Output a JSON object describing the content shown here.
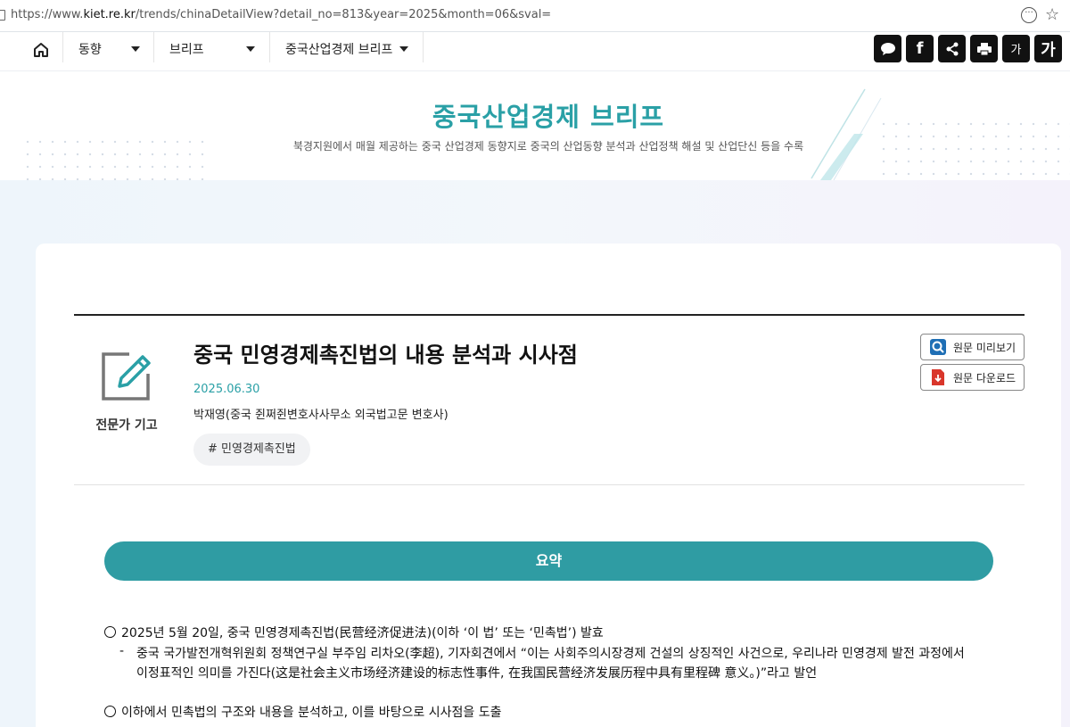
{
  "browser": {
    "url_prefix": "https://www.",
    "url_domain": "kiet.re.kr",
    "url_rest": "/trends/chinaDetailView?detail_no=813&year=2025&month=06&sval="
  },
  "nav": {
    "items": [
      {
        "label": "동향"
      },
      {
        "label": "브리프"
      },
      {
        "label": "중국산업경제 브리프"
      }
    ],
    "tools": [
      {
        "icon": "speech-bubble-icon"
      },
      {
        "icon": "facebook-icon",
        "label": "f"
      },
      {
        "icon": "share-icon"
      },
      {
        "icon": "print-icon"
      },
      {
        "icon": "font-decrease-icon",
        "label": "가"
      },
      {
        "icon": "font-increase-icon",
        "label": "가"
      }
    ]
  },
  "banner": {
    "title": "중국산업경제 브리프",
    "subtitle": "북경지원에서 매월 제공하는 중국 산업경제 동향지로 중국의 산업동향 분석과 산업정책 해설 및 산업단신 등을 수록"
  },
  "article": {
    "category": "전문가 기고",
    "title": "중국 민영경제촉진법의 내용 분석과 시사점",
    "date": "2025.06.30",
    "author": "박재영(중국 쥔쩌쥔변호사사무소 외국법고문 변호사)",
    "tag": "# 민영경제촉진법",
    "preview_label": "원문 미리보기",
    "download_label": "원문 다운로드"
  },
  "summary": {
    "heading": "요약",
    "p1": "2025년 5월 20일, 중국 민영경제촉진법(民营经济促进法)(이하 ‘이 법’ 또는 ‘민촉법’) 발효",
    "dash": "-",
    "p1_sub_line1": "중국 국가발전개혁위원회 정책연구실 부주임 리차오(李超), 기자회견에서 “이는 사회주의시장경제 건설의 상징적인 사건으로, 우리나라 민영경제 발전 과정에서",
    "p1_sub_line2": "이정표적인 의미를 가진다(这是社会主义市场经济建设的标志性事件, 在我国民营经济发展历程中具有里程碑 意义。)”라고 발언",
    "p2": "이하에서 민촉법의 구조와 내용을 분석하고, 이를 바탕으로 시사점을 도출"
  },
  "colors": {
    "accent": "#2aa0a6",
    "summary_bar": "#2f9ca3",
    "tool_bg": "#111111"
  }
}
